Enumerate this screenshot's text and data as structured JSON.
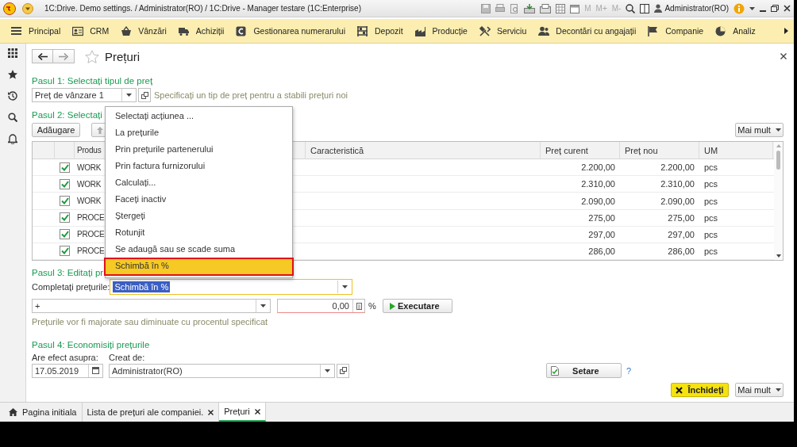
{
  "window": {
    "title": "1C:Drive. Demo settings. / Administrator(RO) / 1C:Drive  - Manager testare (1C:Enterprise)"
  },
  "title_bar": {
    "memory_buttons": [
      {
        "label": "M",
        "disabled": true
      },
      {
        "label": "M+",
        "disabled": true
      },
      {
        "label": "M-",
        "disabled": true
      }
    ],
    "user": "Administrator(RO)"
  },
  "nav": [
    {
      "label": "Principal"
    },
    {
      "label": "CRM"
    },
    {
      "label": "Vânzări"
    },
    {
      "label": "Achiziții"
    },
    {
      "label": "Gestionarea numerarului"
    },
    {
      "label": "Depozit"
    },
    {
      "label": "Producție"
    },
    {
      "label": "Serviciu"
    },
    {
      "label": "Decontări cu angajații"
    },
    {
      "label": "Companie"
    },
    {
      "label": "Analiz"
    }
  ],
  "form": {
    "title": "Prețuri"
  },
  "step1": {
    "heading": "Pasul 1: Selectați tipul de preț",
    "price_type": "Preț de vânzare 1",
    "hint": "Specificați un tip de preț pentru a stabili prețuri noi"
  },
  "step2": {
    "heading": "Pasul 2: Selectați",
    "add_button": "Adăugare",
    "more_button": "Mai mult"
  },
  "table": {
    "columns": [
      "Produs",
      "Caracteristică",
      "Preț curent",
      "Preț nou",
      "UM"
    ],
    "rows": [
      {
        "checked": true,
        "product": "WORK",
        "current_price": "2.200,00",
        "new_price": "2.200,00",
        "unit": "pcs"
      },
      {
        "checked": true,
        "product": "WORK",
        "current_price": "2.310,00",
        "new_price": "2.310,00",
        "unit": "pcs"
      },
      {
        "checked": true,
        "product": "WORK",
        "current_price": "2.090,00",
        "new_price": "2.090,00",
        "unit": "pcs"
      },
      {
        "checked": true,
        "product": "PROCE",
        "current_price": "275,00",
        "new_price": "275,00",
        "unit": "pcs"
      },
      {
        "checked": true,
        "product": "PROCE",
        "current_price": "297,00",
        "new_price": "297,00",
        "unit": "pcs"
      },
      {
        "checked": true,
        "product": "PROCE",
        "current_price": "286,00",
        "new_price": "286,00",
        "unit": "pcs"
      }
    ]
  },
  "action_menu": {
    "items": [
      {
        "label": "Selectați acțiunea ...",
        "selected": false
      },
      {
        "label": "La prețurile",
        "selected": false
      },
      {
        "label": "Prin prețurile partenerului",
        "selected": false
      },
      {
        "label": "Prin factura furnizorului",
        "selected": false
      },
      {
        "label": "Calculați...",
        "selected": false
      },
      {
        "label": "Faceți inactiv",
        "selected": false
      },
      {
        "label": "Ștergeți",
        "selected": false
      },
      {
        "label": "Rotunjit",
        "selected": false
      },
      {
        "label": "Se adaugă sau se scade suma",
        "selected": false
      },
      {
        "label": "Schimbă în %",
        "selected": true
      }
    ]
  },
  "step3": {
    "heading": "Pasul 3: Editați pr",
    "fill_label": "Completați prețurile:",
    "fill_value": "Schimbă în %",
    "focused": true,
    "value_highlighted": true,
    "operation": "+",
    "percent": "0,00",
    "percent_sign": "%",
    "execute_button": "Executare",
    "hint": "Prețurile vor fi majorate sau diminuate cu procentul specificat"
  },
  "step4": {
    "heading": "Pasul 4: Economisiți prețurile",
    "date_label": "Are efect asupra:",
    "date": "17.05.2019",
    "author_label": "Creat de:",
    "author": "Administrator(RO)",
    "settings_button": "Setare",
    "help_link": "?"
  },
  "footer": {
    "close_button": "Închideți",
    "more_button": "Mai mult"
  },
  "open_tabs": [
    {
      "label": "Pagina initiala",
      "kind": "home",
      "selected": false
    },
    {
      "label": "Lista de prețuri ale companiei.",
      "kind": "page",
      "selected": false
    },
    {
      "label": "Prețuri",
      "kind": "page",
      "selected": true
    }
  ]
}
